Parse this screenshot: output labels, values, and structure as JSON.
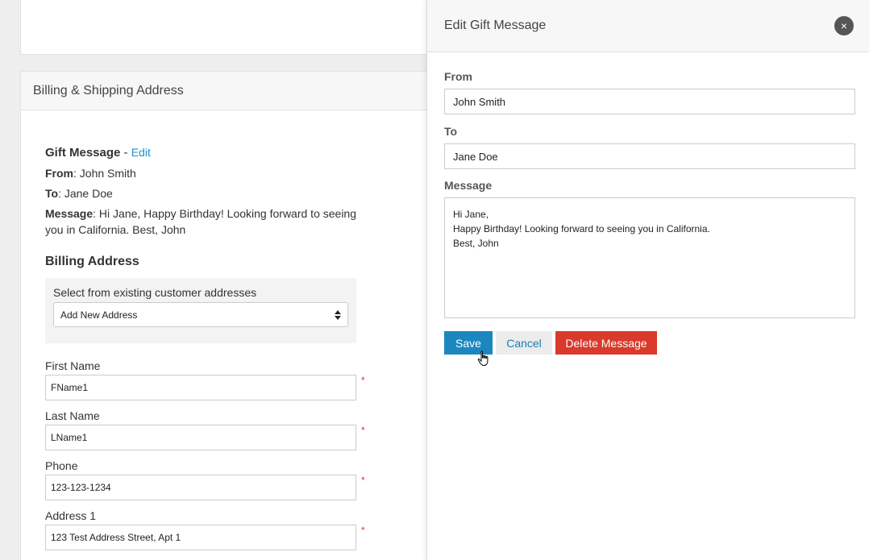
{
  "billing_card": {
    "header": "Billing & Shipping Address",
    "gift": {
      "title": "Gift Message",
      "separator": " - ",
      "edit_link": "Edit",
      "from_label": "From",
      "from_value": ": John Smith",
      "to_label": "To",
      "to_value": ": Jane Doe",
      "message_label": "Message",
      "message_value": ": Hi Jane, Happy Birthday! Looking forward to seeing you in California. Best, John"
    },
    "billing_title": "Billing Address",
    "select_label": "Select from existing customer addresses",
    "select_value": "Add New Address",
    "fields": [
      {
        "label": "First Name",
        "value": "FName1",
        "required": "*"
      },
      {
        "label": "Last Name",
        "value": "LName1",
        "required": "*"
      },
      {
        "label": "Phone",
        "value": "123-123-1234",
        "required": "*"
      },
      {
        "label": "Address 1",
        "value": "123 Test Address Street, Apt 1",
        "required": "*"
      }
    ]
  },
  "panel": {
    "title": "Edit Gift Message",
    "close_icon": "×",
    "from_label": "From",
    "from_value": "John Smith",
    "to_label": "To",
    "to_value": "Jane Doe",
    "message_label": "Message",
    "message_value": "Hi Jane,\nHappy Birthday! Looking forward to seeing you in California.\nBest, John",
    "save_label": "Save",
    "cancel_label": "Cancel",
    "delete_label": "Delete Message"
  },
  "colors": {
    "accent": "#1c87bf",
    "danger": "#d93a2b",
    "link": "#1a8ec9"
  }
}
